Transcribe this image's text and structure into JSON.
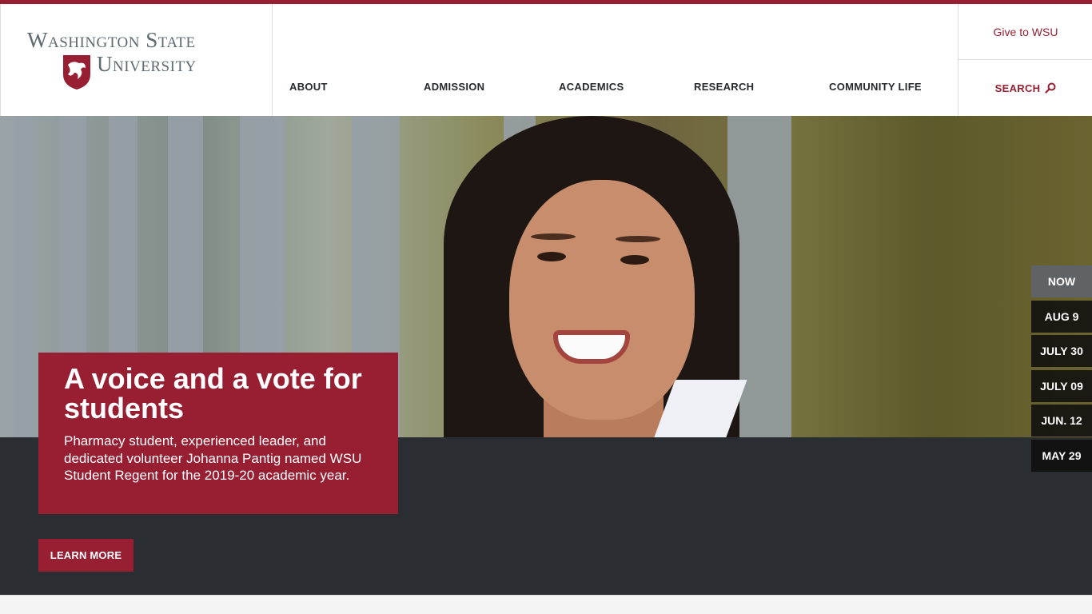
{
  "brand": {
    "line1": "Washington State",
    "line2": "University",
    "primary_color": "#981e32",
    "text_color": "#5e6a71"
  },
  "nav": {
    "items": [
      {
        "label": "ABOUT"
      },
      {
        "label": "ADMISSION"
      },
      {
        "label": "ACADEMICS"
      },
      {
        "label": "RESEARCH"
      },
      {
        "label": "COMMUNITY LIFE"
      }
    ]
  },
  "utility": {
    "give_label": "Give to WSU",
    "search_label": "SEARCH",
    "search_icon": "search-icon"
  },
  "hero": {
    "title": "A voice and a vote for students",
    "body": "Pharmacy student, experienced leader, and dedicated volunteer Johanna Pantig named WSU Student Regent for the 2019-20 academic year.",
    "cta_label": "LEARN MORE",
    "band_color": "#2a2e33"
  },
  "timeline": {
    "items": [
      {
        "label": "NOW",
        "active": true
      },
      {
        "label": "AUG 9",
        "active": false
      },
      {
        "label": "JULY 30",
        "active": false
      },
      {
        "label": "JULY 09",
        "active": false
      },
      {
        "label": "JUN. 12",
        "active": false
      },
      {
        "label": "MAY 29",
        "active": false
      }
    ]
  }
}
